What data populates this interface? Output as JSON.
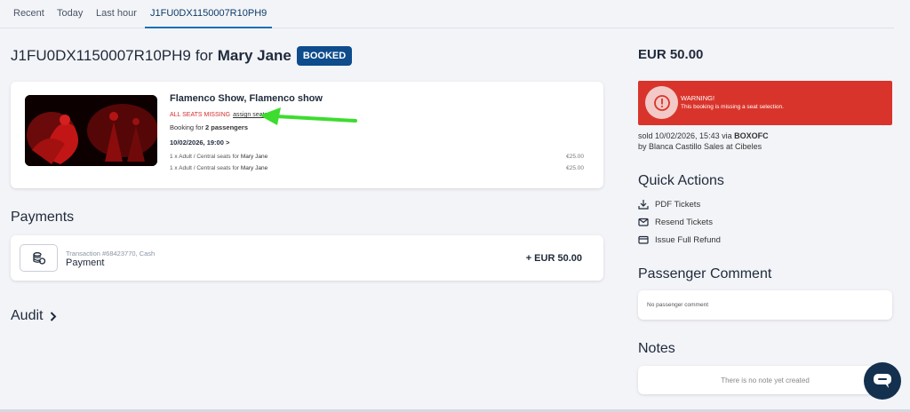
{
  "tabs": [
    {
      "label": "Recent"
    },
    {
      "label": "Today"
    },
    {
      "label": "Last hour"
    },
    {
      "label": "J1FU0DX1150007R10PH9",
      "active": true
    }
  ],
  "header": {
    "booking_ref": "J1FU0DX1150007R10PH9",
    "for_word": "for",
    "customer_name": "Mary Jane",
    "status_badge": "BOOKED"
  },
  "booking": {
    "show_title": "Flamenco Show, Flamenco show",
    "seats_missing_label": "ALL SEATS MISSING",
    "assign_seats_link": "assign seats",
    "booking_for_prefix": "Booking for",
    "passenger_count": "2 passengers",
    "date": "10/02/2026, 19:00 >",
    "items": [
      {
        "desc": "1 x Adult / Central seats for",
        "name": "Mary Jane",
        "price": "€25.00"
      },
      {
        "desc": "1 x Adult / Central seats for",
        "name": "Mary Jane",
        "price": "€25.00"
      }
    ]
  },
  "payments": {
    "heading": "Payments",
    "transaction": "Transaction #68423770, Cash",
    "label": "Payment",
    "amount": "+ EUR 50.00"
  },
  "audit": {
    "heading": "Audit"
  },
  "summary": {
    "total": "EUR 50.00",
    "warning_title": "WARNING!",
    "warning_message": "This booking is missing a seat selection.",
    "sold_line": "sold 10/02/2026, 15:43 via",
    "sold_channel": "BOXOFC",
    "sold_by": "by Blanca Castillo Sales at Cibeles"
  },
  "quick_actions": {
    "heading": "Quick Actions",
    "items": [
      {
        "label": "PDF Tickets",
        "icon": "download-icon"
      },
      {
        "label": "Resend Tickets",
        "icon": "mail-icon"
      },
      {
        "label": "Issue Full Refund",
        "icon": "credit-card-icon"
      }
    ]
  },
  "passenger_comment": {
    "heading": "Passenger Comment",
    "text": "No passenger comment"
  },
  "notes": {
    "heading": "Notes",
    "text": "There is no note yet created"
  },
  "colors": {
    "accent": "#0e4c8c",
    "warning_bg": "#d9342b",
    "missing_text": "#d32f2f",
    "arrow": "#3ddc2f",
    "chat_button": "#14304f"
  }
}
